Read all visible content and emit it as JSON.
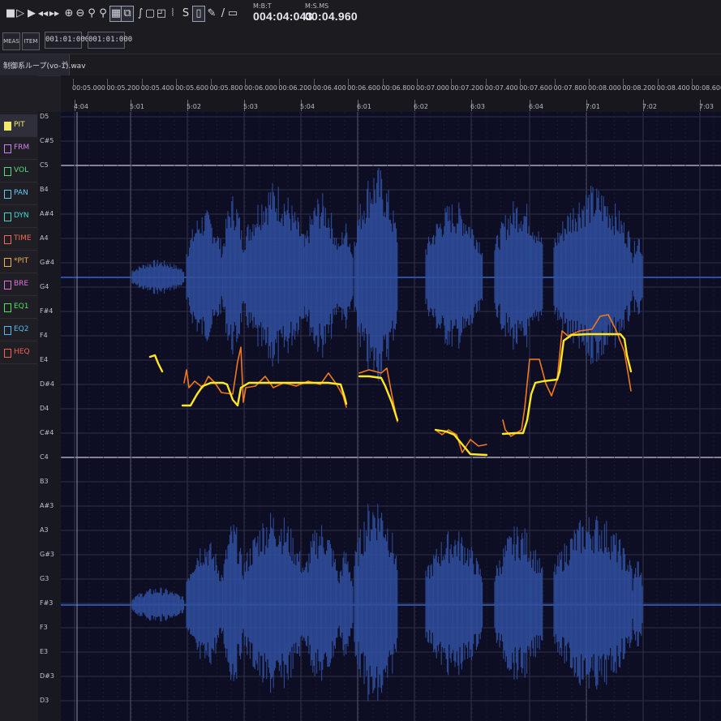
{
  "toolbar": {
    "buttons": [
      {
        "name": "stop-icon",
        "glyph": "■"
      },
      {
        "name": "play-from-start-icon",
        "glyph": "▷"
      },
      {
        "name": "play-icon",
        "glyph": "▶"
      },
      {
        "name": "rewind-icon",
        "glyph": "◀◀"
      },
      {
        "name": "forward-icon",
        "glyph": "▶▶"
      },
      {
        "name": "zoom-tool-icon",
        "glyph": "⊕"
      },
      {
        "name": "zoom-area-icon",
        "glyph": "⊖"
      },
      {
        "name": "magnify-icon",
        "glyph": "⚲"
      },
      {
        "name": "magnify-alt-icon",
        "glyph": "⚲"
      },
      {
        "name": "grid-tool-icon",
        "glyph": "▦"
      },
      {
        "name": "loop-tool-icon",
        "glyph": "⧉"
      },
      {
        "name": "pencil-draw-icon",
        "glyph": "∫"
      },
      {
        "name": "note-edit-icon",
        "glyph": "▢"
      },
      {
        "name": "select-rect-icon",
        "glyph": "◰"
      },
      {
        "name": "snap-icon",
        "glyph": "⦚"
      },
      {
        "name": "s-icon",
        "glyph": "S"
      },
      {
        "name": "frame-icon",
        "glyph": "▯"
      },
      {
        "name": "pen-icon",
        "glyph": "✎"
      },
      {
        "name": "line-tool-icon",
        "glyph": "/"
      },
      {
        "name": "rect-tool-icon",
        "glyph": "▭"
      }
    ],
    "mbt_label": "M:B:T",
    "mbt_value": "004:04:043",
    "msms_label": "M:S.MS",
    "msms_value": "00:04.960"
  },
  "toolbar2": {
    "meas_label": "MEAS",
    "item_label": "ITEM",
    "start_time": "001:01:000",
    "separator": "–",
    "end_time": "001:01:000"
  },
  "tab": {
    "title": "制御系ループ(vo-1).wav",
    "close": "×"
  },
  "tracks": [
    {
      "name": "PIT",
      "color": "#f2e86a",
      "active": true
    },
    {
      "name": "FRM",
      "color": "#d080f0",
      "active": false
    },
    {
      "name": "VOL",
      "color": "#5fd87a",
      "active": false
    },
    {
      "name": "PAN",
      "color": "#66c8f0",
      "active": false
    },
    {
      "name": "DYN",
      "color": "#44d8d0",
      "active": false
    },
    {
      "name": "TIME",
      "color": "#f06a5a",
      "active": false
    },
    {
      "name": "*PIT",
      "color": "#f0b050",
      "active": false
    },
    {
      "name": "BRE",
      "color": "#e070e0",
      "active": false
    },
    {
      "name": "EQ1",
      "color": "#55e060",
      "active": false
    },
    {
      "name": "EQ2",
      "color": "#55b8f0",
      "active": false
    },
    {
      "name": "HEQ",
      "color": "#f06450",
      "active": false
    }
  ],
  "ruler": {
    "times": [
      "00:05.000",
      "00:05.200",
      "00:05.400",
      "00:05.600",
      "00:05.800",
      "00:06.000",
      "00:06.200",
      "00:06.400",
      "00:06.600",
      "00:06.800",
      "00:07.000",
      "00:07.200",
      "00:07.400",
      "00:07.600",
      "00:07.800",
      "00:08.000",
      "00:08.200",
      "00:08.400",
      "00:08.600"
    ],
    "beats": [
      "4:04",
      "5:01",
      "5:02",
      "5:03",
      "5:04",
      "6:01",
      "6:02",
      "6:03",
      "6:04",
      "7:01",
      "7:02",
      "7:03"
    ]
  },
  "notes": [
    "D5",
    "C#5",
    "C5",
    "B4",
    "A#4",
    "A4",
    "G#4",
    "G4",
    "F#4",
    "F4",
    "E4",
    "D#4",
    "D4",
    "C#4",
    "C4",
    "B3",
    "A#3",
    "A3",
    "G#3",
    "G3",
    "F#3",
    "F3",
    "E3",
    "D#3",
    "D3"
  ],
  "colors": {
    "background": "#0d0d24",
    "waveform": "#2f4f9e",
    "pitch_target": "#ffe81e",
    "pitch_detected": "#f07820",
    "grid_line": "#3a3b55",
    "c_line": "#c8c8d8"
  }
}
